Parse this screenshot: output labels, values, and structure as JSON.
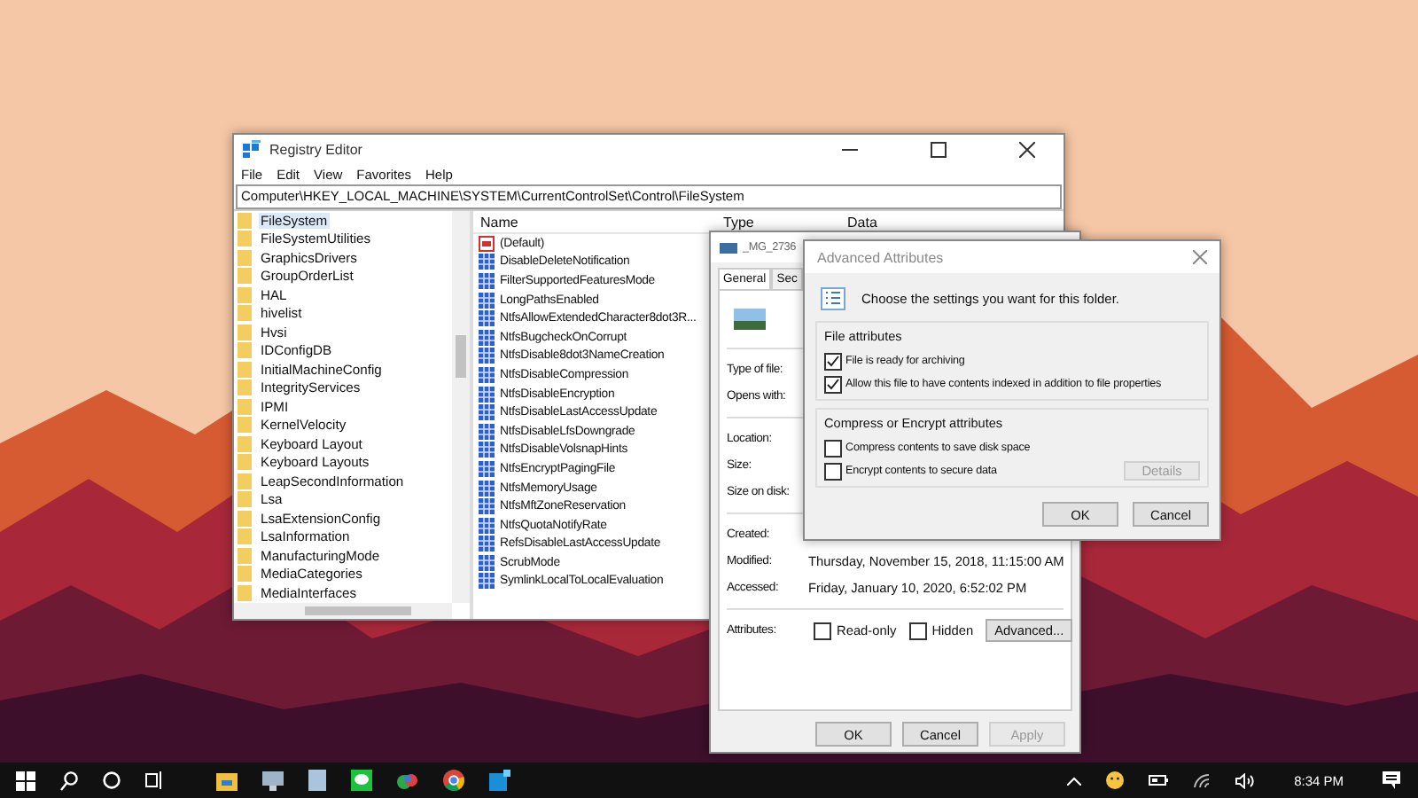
{
  "registry_editor": {
    "title": "Registry Editor",
    "menu": [
      "File",
      "Edit",
      "View",
      "Favorites",
      "Help"
    ],
    "address": "Computer\\HKEY_LOCAL_MACHINE\\SYSTEM\\CurrentControlSet\\Control\\FileSystem",
    "tree": [
      {
        "label": "FileSystem",
        "selected": true
      },
      {
        "label": "FileSystemUtilities",
        "selected": false
      },
      {
        "label": "GraphicsDrivers",
        "selected": false
      },
      {
        "label": "GroupOrderList",
        "selected": false
      },
      {
        "label": "HAL",
        "selected": false
      },
      {
        "label": "hivelist",
        "selected": false
      },
      {
        "label": "Hvsi",
        "selected": false
      },
      {
        "label": "IDConfigDB",
        "selected": false
      },
      {
        "label": "InitialMachineConfig",
        "selected": false
      },
      {
        "label": "IntegrityServices",
        "selected": false
      },
      {
        "label": "IPMI",
        "selected": false
      },
      {
        "label": "KernelVelocity",
        "selected": false
      },
      {
        "label": "Keyboard Layout",
        "selected": false
      },
      {
        "label": "Keyboard Layouts",
        "selected": false
      },
      {
        "label": "LeapSecondInformation",
        "selected": false
      },
      {
        "label": "Lsa",
        "selected": false
      },
      {
        "label": "LsaExtensionConfig",
        "selected": false
      },
      {
        "label": "LsaInformation",
        "selected": false
      },
      {
        "label": "ManufacturingMode",
        "selected": false
      },
      {
        "label": "MediaCategories",
        "selected": false
      },
      {
        "label": "MediaInterfaces",
        "selected": false
      }
    ],
    "columns": [
      "Name",
      "Type",
      "Data"
    ],
    "values": [
      {
        "name": "(Default)",
        "kind": "string"
      },
      {
        "name": "DisableDeleteNotification",
        "kind": "dword"
      },
      {
        "name": "FilterSupportedFeaturesMode",
        "kind": "dword"
      },
      {
        "name": "LongPathsEnabled",
        "kind": "dword"
      },
      {
        "name": "NtfsAllowExtendedCharacter8dot3R...",
        "kind": "dword"
      },
      {
        "name": "NtfsBugcheckOnCorrupt",
        "kind": "dword"
      },
      {
        "name": "NtfsDisable8dot3NameCreation",
        "kind": "dword"
      },
      {
        "name": "NtfsDisableCompression",
        "kind": "dword"
      },
      {
        "name": "NtfsDisableEncryption",
        "kind": "dword"
      },
      {
        "name": "NtfsDisableLastAccessUpdate",
        "kind": "dword"
      },
      {
        "name": "NtfsDisableLfsDowngrade",
        "kind": "dword"
      },
      {
        "name": "NtfsDisableVolsnapHints",
        "kind": "dword"
      },
      {
        "name": "NtfsEncryptPagingFile",
        "kind": "dword"
      },
      {
        "name": "NtfsMemoryUsage",
        "kind": "dword"
      },
      {
        "name": "NtfsMftZoneReservation",
        "kind": "dword"
      },
      {
        "name": "NtfsQuotaNotifyRate",
        "kind": "dword"
      },
      {
        "name": "RefsDisableLastAccessUpdate",
        "kind": "dword"
      },
      {
        "name": "ScrubMode",
        "kind": "dword"
      },
      {
        "name": "SymlinkLocalToLocalEvaluation",
        "kind": "dword"
      }
    ]
  },
  "properties": {
    "title": "_MG_2736",
    "tabs": [
      {
        "label": "General",
        "selected": true
      },
      {
        "label": "Sec",
        "selected": false
      }
    ],
    "groups": [
      [
        {
          "label": "Type of file:"
        },
        {
          "label": "Opens with:"
        }
      ],
      [
        {
          "label": "Location:"
        },
        {
          "label": "Size:"
        },
        {
          "label": "Size on disk:"
        }
      ],
      [
        {
          "label": "Created:"
        },
        {
          "label": "Modified:",
          "value": "Thursday, November 15, 2018, 11:15:00 AM"
        },
        {
          "label": "Accessed:",
          "value": "Friday, January 10, 2020, 6:52:02 PM"
        }
      ]
    ],
    "attributes_label": "Attributes:",
    "attributes": [
      {
        "label": "Read-only",
        "checked": false
      },
      {
        "label": "Hidden",
        "checked": false
      }
    ],
    "advanced_button": "Advanced...",
    "buttons": [
      {
        "label": "OK",
        "disabled": false
      },
      {
        "label": "Cancel",
        "disabled": false
      },
      {
        "label": "Apply",
        "disabled": true
      }
    ]
  },
  "advanced": {
    "title": "Advanced Attributes",
    "intro": "Choose the settings you want for this folder.",
    "groups": [
      {
        "title": "File attributes",
        "options": [
          {
            "label": "File is ready for archiving",
            "checked": true
          },
          {
            "label": "Allow this file to have contents indexed in addition to file properties",
            "checked": true
          }
        ]
      },
      {
        "title": "Compress or Encrypt attributes",
        "options": [
          {
            "label": "Compress contents to save disk space",
            "checked": false
          },
          {
            "label": "Encrypt contents to secure data",
            "checked": false
          }
        ],
        "button": {
          "label": "Details",
          "disabled": true
        }
      }
    ],
    "buttons": [
      {
        "label": "OK",
        "disabled": false
      },
      {
        "label": "Cancel",
        "disabled": false
      }
    ]
  },
  "taskbar": {
    "clock": "8:34 PM"
  }
}
